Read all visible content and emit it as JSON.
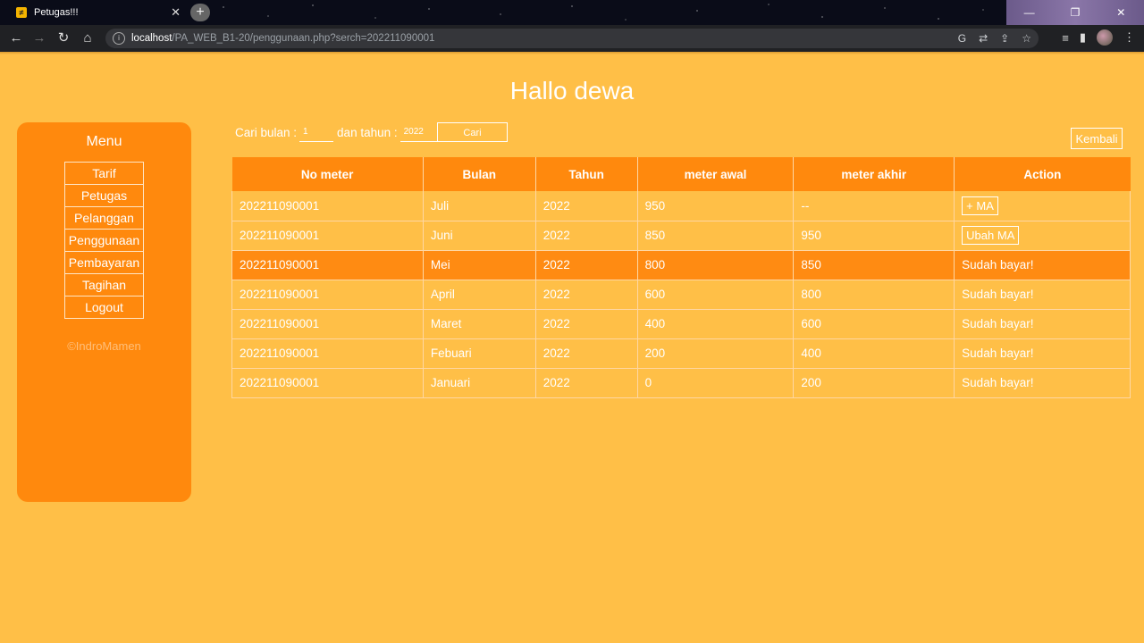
{
  "browser": {
    "tab_title": "Petugas!!!",
    "favicon_text": "≠",
    "url_host": "localhost",
    "url_path": "/PA_WEB_B1-20/penggunaan.php?serch=202211090001"
  },
  "header": {
    "title": "Hallo dewa"
  },
  "sidebar": {
    "title": "Menu",
    "items": [
      {
        "label": "Tarif"
      },
      {
        "label": "Petugas"
      },
      {
        "label": "Pelanggan"
      },
      {
        "label": "Penggunaan"
      },
      {
        "label": "Pembayaran"
      },
      {
        "label": "Tagihan"
      },
      {
        "label": "Logout"
      }
    ],
    "copyright": "©IndroMamen"
  },
  "search": {
    "bulan_label": "Cari bulan :",
    "bulan_value": "1",
    "tahun_label": "dan tahun :",
    "tahun_value": "2022",
    "button": "Cari"
  },
  "back_button": "Kembali",
  "table": {
    "headers": [
      "No meter",
      "Bulan",
      "Tahun",
      "meter awal",
      "meter akhir",
      "Action"
    ],
    "rows": [
      {
        "no_meter": "202211090001",
        "bulan": "Juli",
        "tahun": "2022",
        "meter_awal": "950",
        "meter_akhir": "--",
        "action": "+ MA"
      },
      {
        "no_meter": "202211090001",
        "bulan": "Juni",
        "tahun": "2022",
        "meter_awal": "850",
        "meter_akhir": "950",
        "action": "Ubah MA"
      },
      {
        "no_meter": "202211090001",
        "bulan": "Mei",
        "tahun": "2022",
        "meter_awal": "800",
        "meter_akhir": "850",
        "action": "Sudah bayar!"
      },
      {
        "no_meter": "202211090001",
        "bulan": "April",
        "tahun": "2022",
        "meter_awal": "600",
        "meter_akhir": "800",
        "action": "Sudah bayar!"
      },
      {
        "no_meter": "202211090001",
        "bulan": "Maret",
        "tahun": "2022",
        "meter_awal": "400",
        "meter_akhir": "600",
        "action": "Sudah bayar!"
      },
      {
        "no_meter": "202211090001",
        "bulan": "Febuari",
        "tahun": "2022",
        "meter_awal": "200",
        "meter_akhir": "400",
        "action": "Sudah bayar!"
      },
      {
        "no_meter": "202211090001",
        "bulan": "Januari",
        "tahun": "2022",
        "meter_awal": "0",
        "meter_akhir": "200",
        "action": "Sudah bayar!"
      }
    ]
  },
  "colors": {
    "background": "#ffbf47",
    "accent": "#ff890d"
  }
}
